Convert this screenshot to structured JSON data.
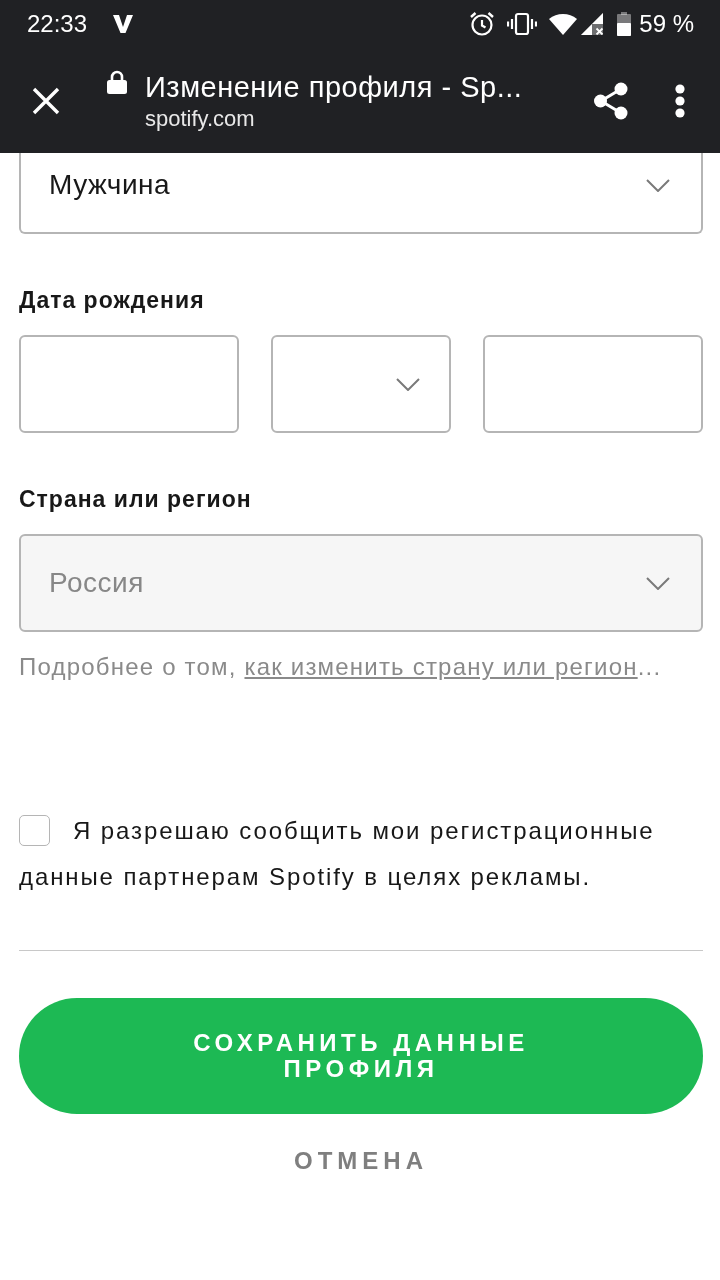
{
  "status_bar": {
    "time": "22:33",
    "battery": "59 %"
  },
  "browser_bar": {
    "title": "Изменение профиля - Sp...",
    "url": "spotify.com"
  },
  "form": {
    "gender": {
      "value": "Мужчина",
      "disabled": false
    },
    "birth_date": {
      "label": "Дата рождения",
      "fields": [
        {
          "kind": "input"
        },
        {
          "kind": "select"
        },
        {
          "kind": "input"
        }
      ]
    },
    "country": {
      "label": "Страна или регион",
      "value": "Россия",
      "disabled": true
    },
    "help": {
      "prefix": "Подробнее о том,",
      "link": "как изменить страну или регион",
      "suffix": "..."
    },
    "consent": {
      "label": "Я разрешаю сообщить мои регистрационные данные партнерам Spotify в целях рекламы.",
      "checked": false
    },
    "save_button": "СОХРАНИТЬ ДАННЫЕ ПРОФИЛЯ",
    "cancel_button": "ОТМЕНА"
  }
}
